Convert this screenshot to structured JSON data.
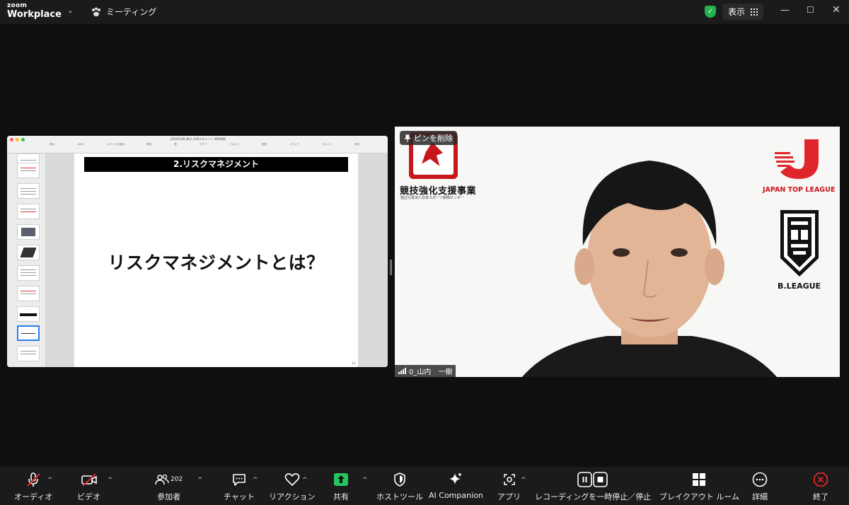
{
  "app": {
    "brand_small": "zoom",
    "brand_large": "Workplace",
    "meeting_label": "ミーティング"
  },
  "topbar": {
    "view_label": "表示",
    "icons": [
      "shield-check-icon",
      "grid-icon",
      "minimize-icon",
      "maximize-icon",
      "close-icon"
    ]
  },
  "presentation": {
    "window_title": "_20241218_BLG_U18アスリート SNS研修",
    "toolbar_items": [
      "表示",
      "拡大/縮小",
      "スライドを追加",
      "再生",
      "表",
      "グラフ",
      "テキスト",
      "図形",
      "メディア",
      "コメント",
      "共有"
    ],
    "zoom": "100%",
    "slide_header": "2.リスクマネジメント",
    "slide_body": "リスクマネジメントとは？",
    "slide_number": "14"
  },
  "video": {
    "pin_label": "ピンを削除",
    "org_name": "競技強化支援事業",
    "org_sub": "独立行政法人日本スポーツ振興センター",
    "logo1_text": "JAPAN TOP LEAGUE",
    "logo2_text": "B.LEAGUE",
    "participant_name": "0_山内　一樹"
  },
  "toolbar": {
    "audio": "オーディオ",
    "video": "ビデオ",
    "participants": "参加者",
    "participants_count": "202",
    "chat": "チャット",
    "reactions": "リアクション",
    "share": "共有",
    "host_tools": "ホストツール",
    "ai_companion": "AI Companion",
    "apps": "アプリ",
    "recording": "レコーディングを一時停止／停止",
    "breakout": "ブレイクアウト ルーム",
    "more": "詳細",
    "end": "終了"
  },
  "colors": {
    "share_green": "#23c55e",
    "end_red": "#e02828",
    "jsc_red": "#c8161d"
  }
}
